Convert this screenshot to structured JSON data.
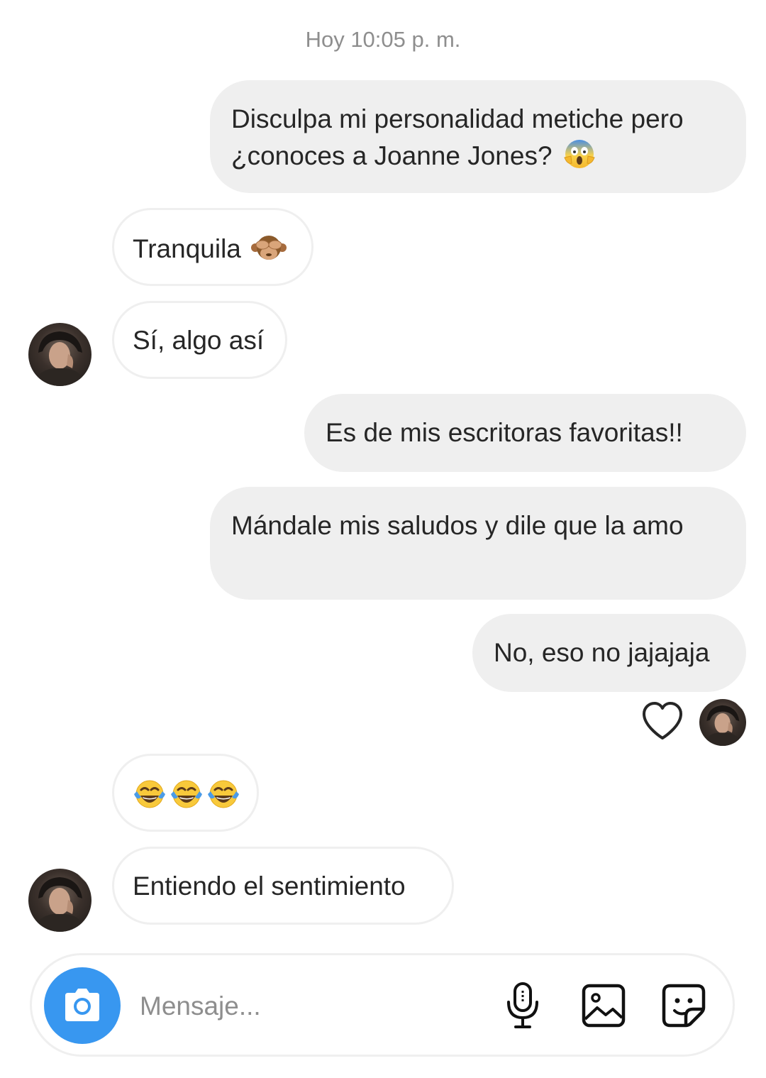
{
  "thread": {
    "timestamp": "Hoy 10:05 p. m.",
    "messages": [
      {
        "from": "me",
        "text": "Disculpa mi personalidad metiche pero ¿conoces a Joanne Jones?",
        "emoji": "face-screaming-in-fear"
      },
      {
        "from": "them",
        "text": "Tranquila",
        "emoji": "see-no-evil-monkey"
      },
      {
        "from": "them",
        "text": "Sí, algo así"
      },
      {
        "from": "me",
        "text": "Es de mis escritoras favoritas!!"
      },
      {
        "from": "me",
        "text": "Mándale mis saludos y dile que la amo"
      },
      {
        "from": "me",
        "text": "No, eso no jajajaja",
        "reaction": "heart-outline"
      },
      {
        "from": "them",
        "text": "",
        "emoji": "face-with-tears-of-joy ×3"
      },
      {
        "from": "them",
        "text": "Entiendo el sentimiento"
      }
    ]
  },
  "composer": {
    "placeholder": "Mensaje...",
    "camera_icon": "camera-icon",
    "microphone_icon": "microphone-icon",
    "gallery_icon": "gallery-icon",
    "sticker_icon": "sticker-icon"
  },
  "colors": {
    "sent_bubble": "#efefef",
    "received_border": "#efefef",
    "camera_button": "#3897f0",
    "meta_text": "#8e8e8e",
    "text": "#262626"
  }
}
